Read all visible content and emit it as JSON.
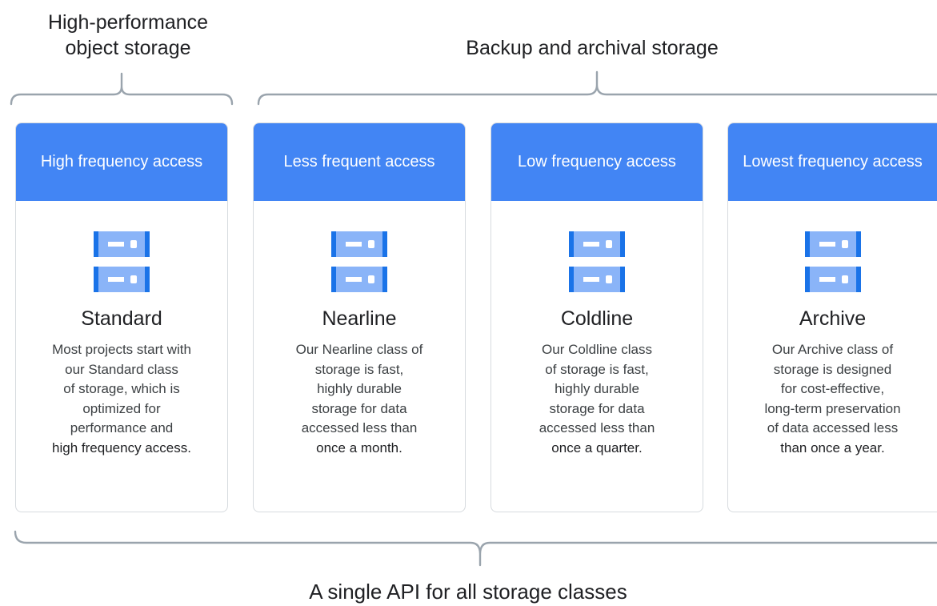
{
  "groups": {
    "high_performance": [
      "High-performance",
      "object storage"
    ],
    "backup": "Backup and archival storage",
    "api": "A single API for all storage classes"
  },
  "colors": {
    "header_blue": "#4285f4",
    "icon_dark": "#1a73e8",
    "icon_light": "#8ab4f8",
    "bracket": "#9aa4ad"
  },
  "cards": [
    {
      "header": "High frequency access",
      "icon": "server-stack-icon",
      "title": "Standard",
      "lines": [
        "Most projects start with",
        "our Standard class",
        "of storage, which is",
        "optimized for",
        "performance and",
        "high frequency access."
      ]
    },
    {
      "header": "Less frequent access",
      "icon": "server-stack-icon",
      "title": "Nearline",
      "lines": [
        "Our Nearline class of",
        "storage is fast,",
        "highly durable",
        "storage for data",
        "accessed less than",
        "once a month."
      ]
    },
    {
      "header": "Low frequency access",
      "icon": "server-stack-icon",
      "title": "Coldline",
      "lines": [
        "Our Coldline class",
        "of storage is fast,",
        "highly durable",
        "storage for data",
        "accessed less than",
        "once a quarter."
      ]
    },
    {
      "header": "Lowest frequency access",
      "icon": "server-stack-icon",
      "title": "Archive",
      "lines": [
        "Our Archive class of",
        "storage is designed",
        "for cost-effective,",
        "long-term preservation",
        "of data accessed less",
        "than once a year."
      ]
    }
  ]
}
